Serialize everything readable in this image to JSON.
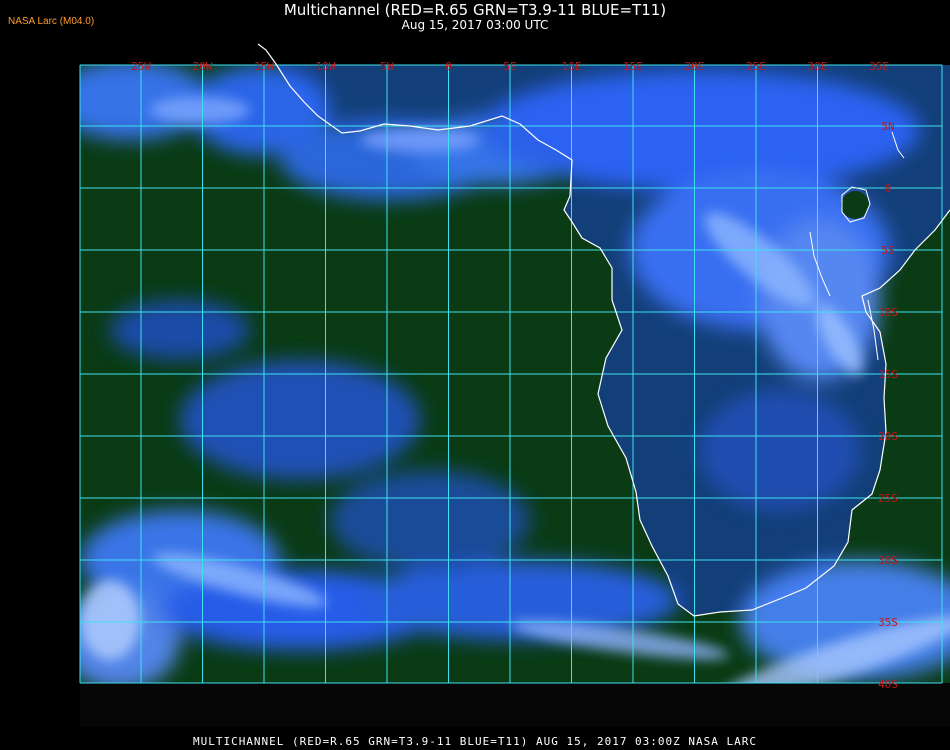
{
  "header": {
    "title": "Multichannel (RED=R.65 GRN=T3.9-11 BLUE=T11)",
    "subtitle": "Aug 15, 2017 03:00 UTC",
    "credit": "NASA Larc (M04.0)"
  },
  "footer": {
    "caption": "MULTICHANNEL (RED=R.65 GRN=T3.9-11 BLUE=T11) AUG 15, 2017 03:00Z    NASA LARC"
  },
  "map": {
    "longitude_labels": [
      "25W",
      "20W",
      "15W",
      "10W",
      "5W",
      "0",
      "5E",
      "10E",
      "15E",
      "20E",
      "25E",
      "30E",
      "35E"
    ],
    "latitude_labels": [
      "5N",
      "0",
      "5S",
      "10S",
      "15S",
      "20S",
      "25S",
      "30S",
      "35S",
      "40S"
    ],
    "colors": {
      "ocean": "#0a3b14",
      "cloud": "#2f6cff",
      "cloud_bright": "#8fb8ff",
      "grid": "#3fe0f0",
      "coast": "#ffffff",
      "grid_label": "#c01818"
    }
  }
}
